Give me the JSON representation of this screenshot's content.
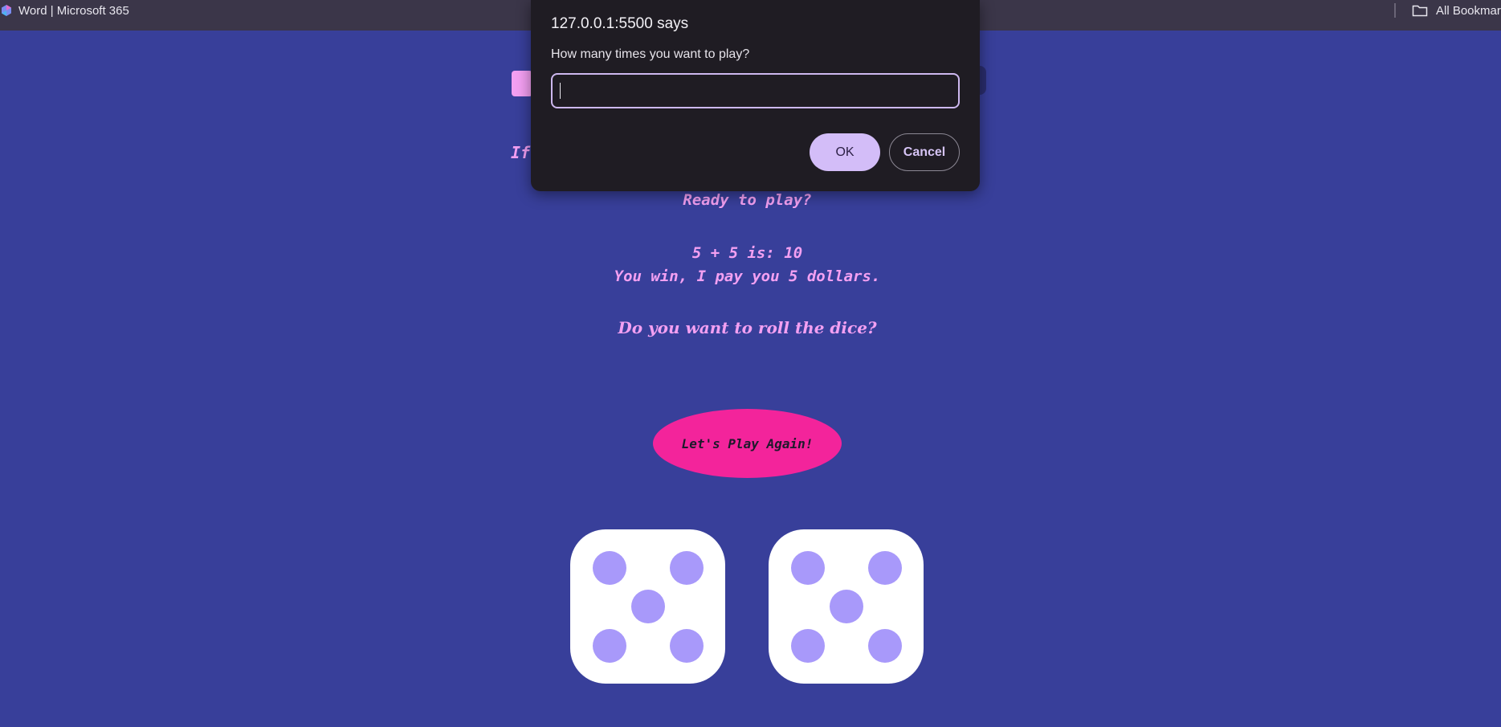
{
  "bookmarks_bar": {
    "left_item": "Word | Microsoft 365",
    "right_item": "All Bookmar"
  },
  "page": {
    "partial_heading": "If",
    "ready_text": "Ready to play?",
    "roll_result": "5 + 5 is: 10",
    "outcome": "You win, I pay you 5 dollars.",
    "question": "Do you want to roll the dice?",
    "play_button": "Let's Play Again!",
    "dice": [
      5,
      5
    ]
  },
  "dialog": {
    "title": "127.0.0.1:5500 says",
    "message": "How many times you want to play?",
    "input_value": "",
    "ok_label": "OK",
    "cancel_label": "Cancel"
  },
  "colors": {
    "page_background": "#383f9a",
    "text_pink": "#f3a0f2",
    "button_pink": "#f3249b",
    "pip_purple": "#a899fa",
    "dialog_background": "#1f1c23",
    "ok_button": "#d3bdf8"
  }
}
